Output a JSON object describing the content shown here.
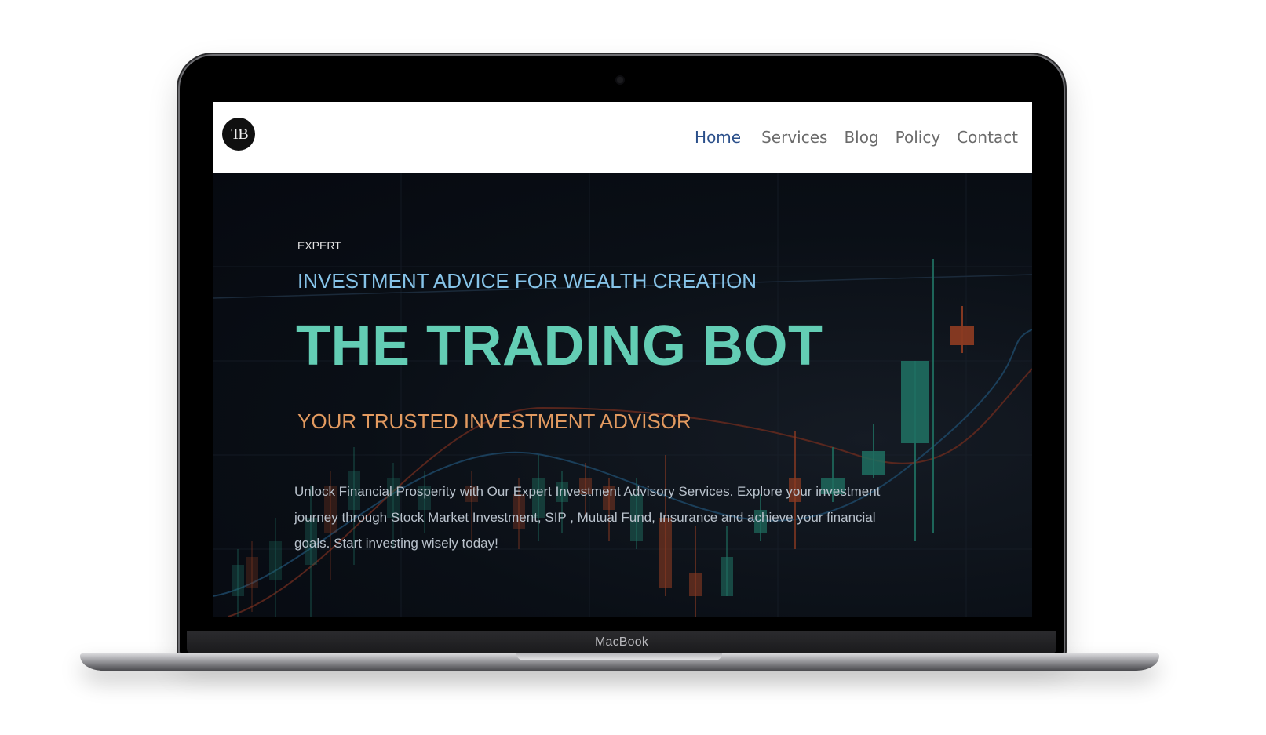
{
  "device": {
    "brand_label": "MacBook"
  },
  "site": {
    "logo_text": "TB",
    "nav": [
      {
        "label": "Home",
        "active": true
      },
      {
        "label": "Services",
        "active": false
      },
      {
        "label": "Blog",
        "active": false
      },
      {
        "label": "Policy",
        "active": false
      },
      {
        "label": "Contact",
        "active": false
      }
    ]
  },
  "hero": {
    "eyebrow": "EXPERT",
    "subtitle": "INVESTMENT ADVICE FOR WEALTH CREATION",
    "headline": "THE TRADING BOT",
    "tagline": "YOUR TRUSTED INVESTMENT ADVISOR",
    "body": "Unlock Financial Prosperity with Our Expert Investment Advisory Services. Explore your investment journey through Stock Market Investment, SIP , Mutual Fund, Insurance and achieve your financial goals. Start investing wisely today!",
    "background": "candlestick-chart-background"
  },
  "colors": {
    "nav_active": "#2a4f8a",
    "nav_inactive": "#6b6b6b",
    "subtitle": "#86c3e8",
    "headline": "#63cdb4",
    "tagline": "#e29a60",
    "candle_up": "#1f6e60",
    "candle_down": "#8a3a22"
  }
}
